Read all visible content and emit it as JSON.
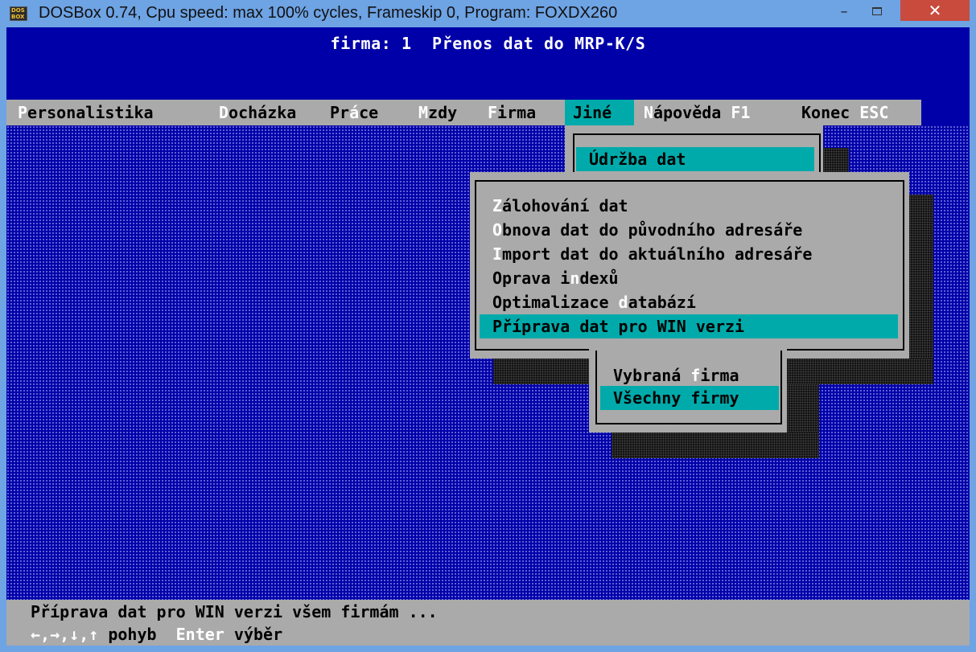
{
  "window": {
    "title": "DOSBox 0.74, Cpu speed: max 100% cycles, Frameskip  0, Program: FOXDX260",
    "icon": "dosbox-icon",
    "icon_text": [
      "DOS",
      "BOX"
    ],
    "controls": {
      "minimize": "–",
      "close": "✕"
    }
  },
  "header": {
    "text": "firma: 1  Přenos dat do MRP-K/S"
  },
  "menubar": {
    "items": [
      {
        "hot": "P",
        "rest": "ersonalistika"
      },
      {
        "hot": "D",
        "rest": "ocházka"
      },
      {
        "pre": "Pr",
        "hot": "á",
        "rest": "ce"
      },
      {
        "hot": "M",
        "rest": "zdy"
      },
      {
        "hot": "F",
        "rest": "irma"
      },
      {
        "label": "Jiné",
        "active": true
      },
      {
        "hot": "N",
        "rest": "ápověda",
        "key": " F1"
      },
      {
        "label": "Konec",
        "key": " ESC"
      }
    ]
  },
  "menu_jine": {
    "items": [
      {
        "label": "Údržba dat",
        "selected": true
      }
    ]
  },
  "menu_udrzba": {
    "items": [
      {
        "hot": "Z",
        "rest": "álohování dat"
      },
      {
        "hot": "O",
        "rest": "bnova dat do původního adresáře"
      },
      {
        "hot": "I",
        "rest": "mport dat do aktuálního adresáře"
      },
      {
        "pre": "Oprava i",
        "hot": "n",
        "rest": "dexů"
      },
      {
        "pre": "Optimalizace ",
        "hot": "d",
        "rest": "atabází"
      },
      {
        "label": "Příprava dat pro WIN verzi",
        "selected": true
      }
    ]
  },
  "menu_firmy": {
    "items": [
      {
        "pre": "Vybraná ",
        "hot": "f",
        "rest": "irma"
      },
      {
        "label": "Všechny firmy",
        "selected": true
      }
    ]
  },
  "status": {
    "message": "Příprava dat pro WIN verzi všem firmám ...",
    "keys": [
      {
        "key": "←,→,↓,↑",
        "desc": " pohyb"
      },
      {
        "key": "Enter",
        "desc": " výběr"
      }
    ]
  },
  "colors": {
    "dos_blue": "#0000a8",
    "gray": "#aaaaaa",
    "cyan": "#00aaaa",
    "titlebar": "#6ea3e4",
    "close": "#c84b3d"
  }
}
